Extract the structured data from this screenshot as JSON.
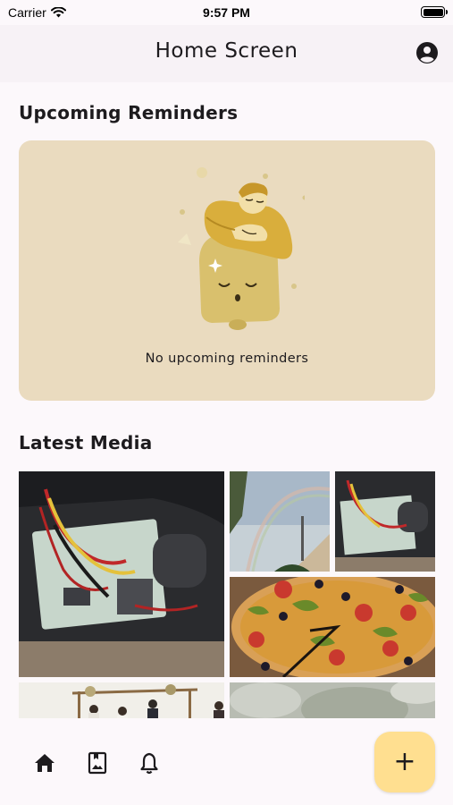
{
  "status_bar": {
    "carrier": "Carrier",
    "time": "9:57 PM",
    "icons": [
      "wifi-icon",
      "battery-icon"
    ]
  },
  "app_bar": {
    "title": "Home Screen",
    "profile_icon": "account-circle-icon"
  },
  "reminders": {
    "title": "Upcoming Reminders",
    "empty_text": "No upcoming reminders",
    "card_color": "#eadbbf",
    "illustration": "sleeping-person-on-bell"
  },
  "media": {
    "title": "Latest Media",
    "items": [
      {
        "subject": "circuit board with red, yellow and black wires inside a device"
      },
      {
        "subject": "sky with rainbow, palm tree and antennas on a building"
      },
      {
        "subject": "circuit board with wires close-up"
      },
      {
        "subject": "pizza with olives, tomatoes and herbs on a plate"
      },
      {
        "subject": "outdoor wedding ceremony under floral arch"
      },
      {
        "subject": "blurred grey-green textured surface"
      }
    ]
  },
  "bottom_nav": {
    "items": [
      {
        "name": "home",
        "icon": "home-icon"
      },
      {
        "name": "media",
        "icon": "photo-album-icon"
      },
      {
        "name": "reminders",
        "icon": "bell-icon"
      }
    ],
    "fab_label": "+",
    "fab_color": "#ffdf90"
  },
  "colors": {
    "background": "#fcf8fb",
    "app_bar": "#f7f2f6",
    "text": "#1d1b1e",
    "accent": "#ffdf90"
  }
}
